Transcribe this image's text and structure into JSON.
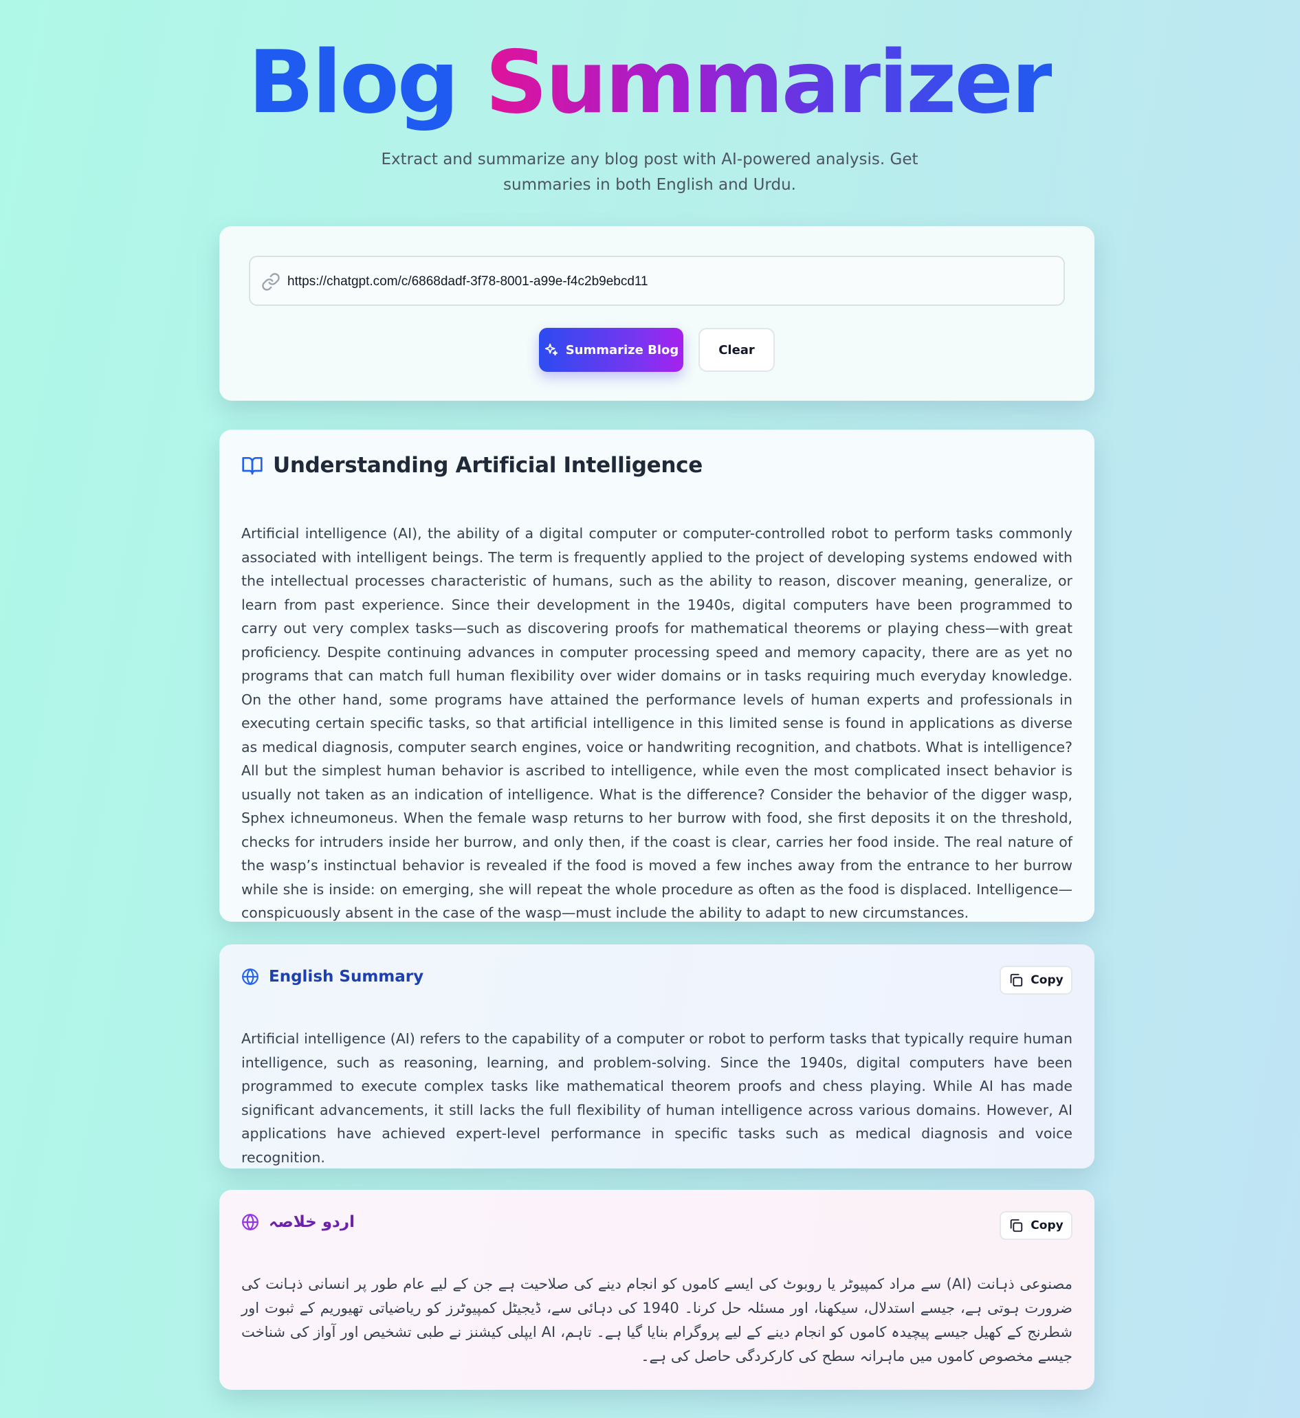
{
  "header": {
    "title_part1": "Blog",
    "title_part2": "Summarizer",
    "subtitle": "Extract and summarize any blog post with AI-powered analysis. Get summaries in both English and Urdu."
  },
  "input": {
    "url_value": "https://chatgpt.com/c/6868dadf-3f78-8001-a99e-f4c2b9ebcd11",
    "summarize_label": "Summarize Blog",
    "clear_label": "Clear"
  },
  "article": {
    "title": "Understanding Artificial Intelligence",
    "body": "Artificial intelligence (AI), the ability of a digital computer or computer-controlled robot to perform tasks commonly associated with intelligent beings. The term is frequently applied to the project of developing systems endowed with the intellectual processes characteristic of humans, such as the ability to reason, discover meaning, generalize, or learn from past experience. Since their development in the 1940s, digital computers have been programmed to carry out very complex tasks—such as discovering proofs for mathematical theorems or playing chess—with great proficiency. Despite continuing advances in computer processing speed and memory capacity, there are as yet no programs that can match full human flexibility over wider domains or in tasks requiring much everyday knowledge. On the other hand, some programs have attained the performance levels of human experts and professionals in executing certain specific tasks, so that artificial intelligence in this limited sense is found in applications as diverse as medical diagnosis, computer search engines, voice or handwriting recognition, and chatbots. What is intelligence? All but the simplest human behavior is ascribed to intelligence, while even the most complicated insect behavior is usually not taken as an indication of intelligence. What is the difference? Consider the behavior of the digger wasp, Sphex ichneumoneus. When the female wasp returns to her burrow with food, she first deposits it on the threshold, checks for intruders inside her burrow, and only then, if the coast is clear, carries her food inside. The real nature of the wasp’s instinctual behavior is revealed if the food is moved a few inches away from the entrance to her burrow while she is inside: on emerging, she will repeat the whole procedure as often as the food is displaced. Intelligence—conspicuously absent in the case of the wasp—must include the ability to adapt to new circumstances."
  },
  "english_summary": {
    "title": "English Summary",
    "copy_label": "Copy",
    "body": "Artificial intelligence (AI) refers to the capability of a computer or robot to perform tasks that typically require human intelligence, such as reasoning, learning, and problem-solving. Since the 1940s, digital computers have been programmed to execute complex tasks like mathematical theorem proofs and chess playing. While AI has made significant advancements, it still lacks the full flexibility of human intelligence across various domains. However, AI applications have achieved expert-level performance in specific tasks such as medical diagnosis and voice recognition."
  },
  "urdu_summary": {
    "title": "اردو خلاصہ",
    "copy_label": "Copy",
    "body": "مصنوعی ذہانت (AI) سے مراد کمپیوٹر یا روبوٹ کی ایسے کاموں کو انجام دینے کی صلاحیت ہے جن کے لیے عام طور پر انسانی ذہانت کی ضرورت ہوتی ہے، جیسے استدلال، سیکھنا، اور مسئلہ حل کرنا۔ 1940 کی دہائی سے، ڈیجیٹل کمپیوٹرز کو ریاضیاتی تھیوریم کے ثبوت اور شطرنج کے کھیل جیسے پیچیدہ کاموں کو انجام دینے کے لیے پروگرام بنایا گیا ہے۔ تاہم، AI ایپلی کیشنز نے طبی تشخیص اور آواز کی شناخت جیسے مخصوص کاموں میں ماہرانہ سطح کی کارکردگی حاصل کی ہے۔"
  },
  "colors": {
    "accent_blue": "#1f5bf0",
    "accent_magenta": "#e0139a",
    "accent_purple": "#7a35f0"
  },
  "icons": {
    "url": "link-icon",
    "summarize": "sparkles-icon",
    "article": "book-open-icon",
    "english": "globe-icon",
    "urdu": "globe-icon",
    "copy": "copy-icon"
  }
}
